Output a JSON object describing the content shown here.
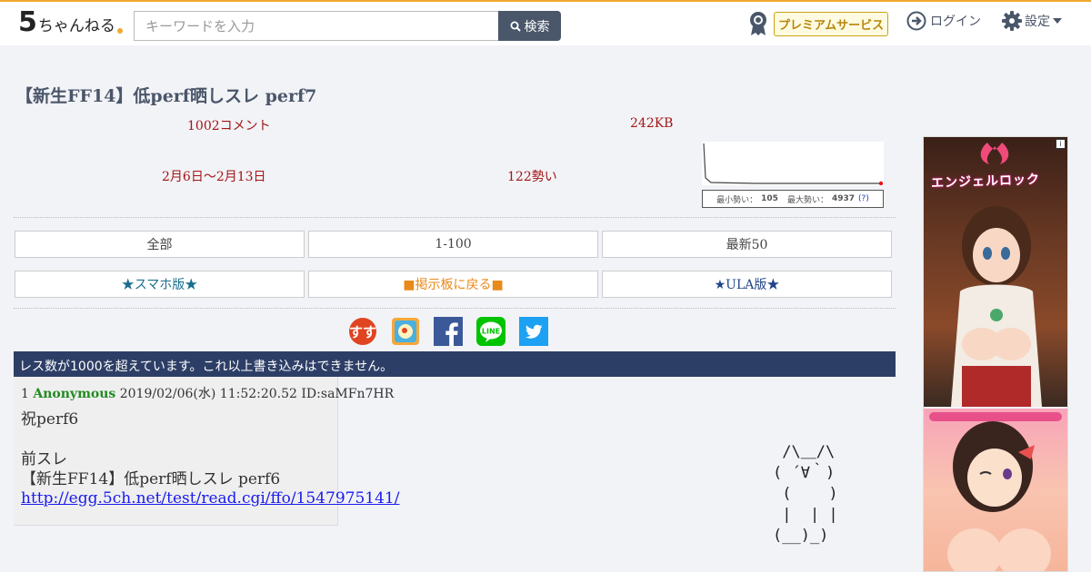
{
  "header": {
    "logo": {
      "main": "5",
      "rest": "ちゃんねる"
    },
    "search_placeholder": "キーワードを入力",
    "search_button": "検索",
    "premium_label": "プレミアムサービス",
    "login_label": "ログイン",
    "settings_label": "設定"
  },
  "thread": {
    "title": "【新生FF14】低perf晒しスレ perf7",
    "comments": "1002コメント",
    "size": "242KB",
    "date_range": "2月6日〜2月13日",
    "momentum": "122勢い",
    "graph_stats": {
      "min_label": "最小勢い：",
      "min_value": "105",
      "max_label": "最大勢い：",
      "max_value": "4937",
      "help": "(?)"
    }
  },
  "nav": {
    "all": "全部",
    "range": "1-100",
    "latest": "最新50",
    "smartphone": "★スマホ版★",
    "back_to_board": "■掲示板に戻る■",
    "ula": "★ULA版★"
  },
  "share": [
    "matome-icon",
    "bookmark-icon",
    "facebook-icon",
    "line-icon",
    "twitter-icon"
  ],
  "notice": "レス数が1000を超えています。これ以上書き込みはできません。",
  "post": {
    "number": "1",
    "name": "Anonymous",
    "date": "2019/02/06(水) 11:52:20.52",
    "id": "ID:saMFn7HR",
    "body": "祝perf6\n\n前スレ\n【新生FF14】低perf晒しスレ perf6",
    "link": "http://egg.5ch.net/test/read.cgi/ffo/1547975141/"
  },
  "ascii_art": " /\\＿/\\\n( ´∀｀)\n (    )\n |  | |\n(__)_)",
  "ad": {
    "title": "エンジェルロック",
    "info": "i"
  },
  "colors": {
    "accent": "#f0a830",
    "notice_bg": "#2d3e66",
    "stat_red": "#a31515",
    "name_green": "#228b22"
  }
}
